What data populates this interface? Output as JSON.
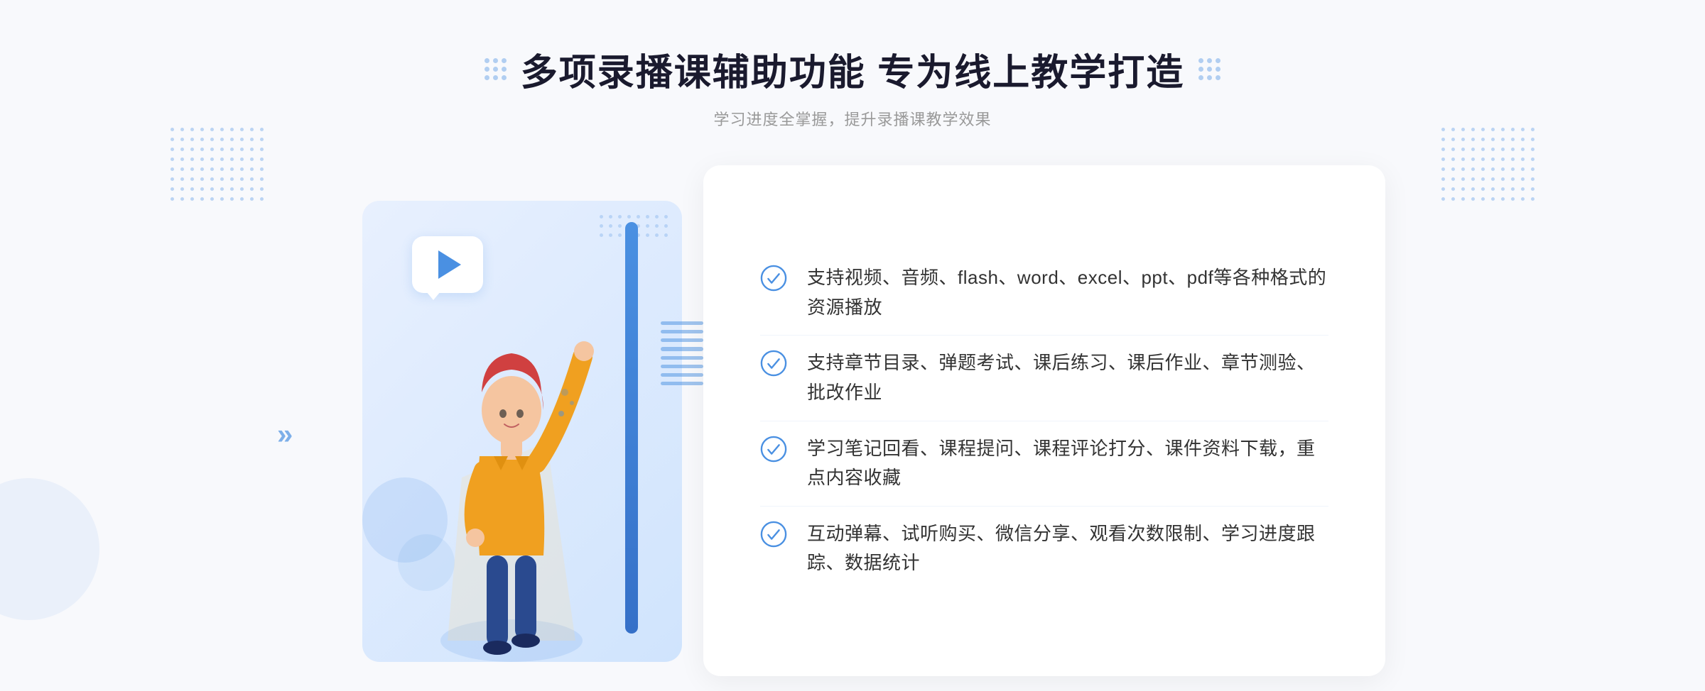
{
  "header": {
    "title": "多项录播课辅助功能 专为线上教学打造",
    "subtitle": "学习进度全掌握，提升录播课教学效果",
    "decorator_dots_left": "grid-dots-left",
    "decorator_dots_right": "grid-dots-right"
  },
  "features": [
    {
      "id": 1,
      "text": "支持视频、音频、flash、word、excel、ppt、pdf等各种格式的资源播放",
      "icon": "check-circle-icon"
    },
    {
      "id": 2,
      "text": "支持章节目录、弹题考试、课后练习、课后作业、章节测验、批改作业",
      "icon": "check-circle-icon"
    },
    {
      "id": 3,
      "text": "学习笔记回看、课程提问、课程评论打分、课件资料下载，重点内容收藏",
      "icon": "check-circle-icon"
    },
    {
      "id": 4,
      "text": "互动弹幕、试听购买、微信分享、观看次数限制、学习进度跟踪、数据统计",
      "icon": "check-circle-icon"
    }
  ],
  "illustration": {
    "play_button": "play-triangle",
    "chevron": "«"
  },
  "colors": {
    "primary_blue": "#4a90e2",
    "dark_blue": "#3570c8",
    "text_dark": "#1a1a2e",
    "text_gray": "#999999",
    "text_body": "#333333",
    "bg_light": "#f8f9fc",
    "bg_card": "#e8f0fe",
    "white": "#ffffff"
  }
}
